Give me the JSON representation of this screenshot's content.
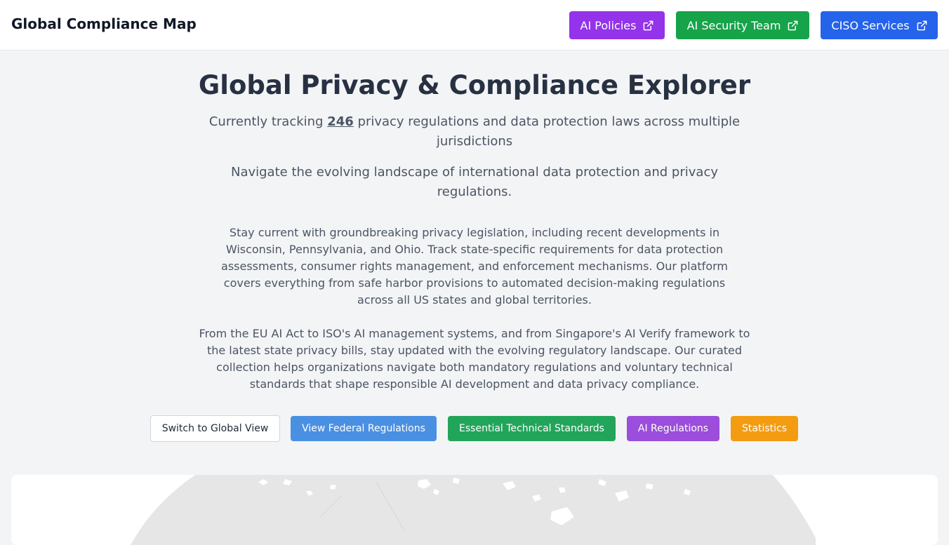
{
  "header": {
    "brand": "Global Compliance Map",
    "links": [
      {
        "label": "AI Policies",
        "color": "#9333ea",
        "icon": "external-link-icon"
      },
      {
        "label": "AI Security Team",
        "color": "#16a34a",
        "icon": "external-link-icon"
      },
      {
        "label": "CISO Services",
        "color": "#2563eb",
        "icon": "external-link-icon"
      }
    ]
  },
  "hero": {
    "title": "Global Privacy & Compliance Explorer",
    "tracking_prefix": "Currently tracking ",
    "tracking_count": "246",
    "tracking_suffix": " privacy regulations and data protection laws across multiple jurisdictions",
    "navigate": "Navigate the evolving landscape of international data protection and privacy regulations.",
    "paragraph1": "Stay current with groundbreaking privacy legislation, including recent developments in Wisconsin, Pennsylvania, and Ohio. Track state-specific requirements for data protection assessments, consumer rights management, and enforcement mechanisms. Our platform covers everything from safe harbor provisions to automated decision-making regulations across all US states and global territories.",
    "paragraph2": "From the EU AI Act to ISO's AI management systems, and from Singapore's AI Verify framework to the latest state privacy bills, stay updated with the evolving regulatory landscape. Our curated collection helps organizations navigate both mandatory regulations and voluntary technical standards that shape responsible AI development and data privacy compliance."
  },
  "actions": [
    {
      "label": "Switch to Global View",
      "color": "#ffffff"
    },
    {
      "label": "View Federal Regulations",
      "color": "#4a90e2"
    },
    {
      "label": "Essential Technical Standards",
      "color": "#22a55a"
    },
    {
      "label": "AI Regulations",
      "color": "#9b4ddb"
    },
    {
      "label": "Statistics",
      "color": "#f39c12"
    }
  ],
  "map": {
    "land_color": "#e6e6e6",
    "background": "#ffffff"
  }
}
